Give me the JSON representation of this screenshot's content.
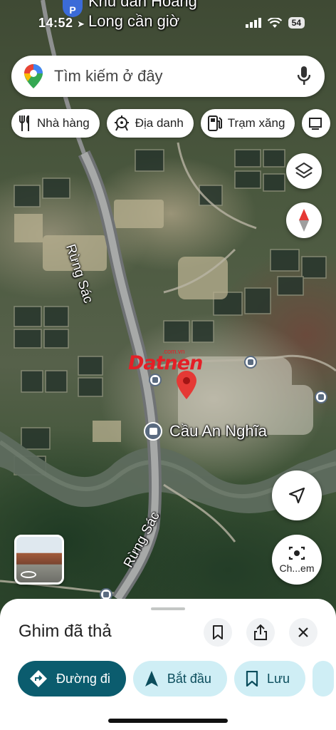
{
  "status_bar": {
    "time": "14:52",
    "battery": "54"
  },
  "map_top_labels": {
    "poi_line1": "Khu dân Hoàng",
    "poi_line2": "Long cần giờ"
  },
  "search": {
    "placeholder": "Tìm kiếm ở đây"
  },
  "chips": [
    {
      "label": "Nhà hàng",
      "icon": "fork-knife-icon"
    },
    {
      "label": "Địa danh",
      "icon": "landmark-icon"
    },
    {
      "label": "Trạm xăng",
      "icon": "gas-station-icon"
    }
  ],
  "map_labels": {
    "road1": "Rừng Sác",
    "road2": "Rừng Sác",
    "place": "Cầu An Nghĩa",
    "watermark_main": "Datnen",
    "watermark_sub": ".com.vn"
  },
  "street_view": {
    "label": "Ch...em"
  },
  "sheet": {
    "title": "Ghim đã thả",
    "actions": [
      {
        "label": "Đường đi",
        "icon": "directions-icon"
      },
      {
        "label": "Bắt đầu",
        "icon": "navigation-arrow-icon"
      },
      {
        "label": "Lưu",
        "icon": "bookmark-icon"
      }
    ]
  },
  "colors": {
    "accent": "#0b5c6e",
    "accent_soft": "#cfeef5",
    "pin": "#e53935",
    "watermark": "#e41f26"
  }
}
